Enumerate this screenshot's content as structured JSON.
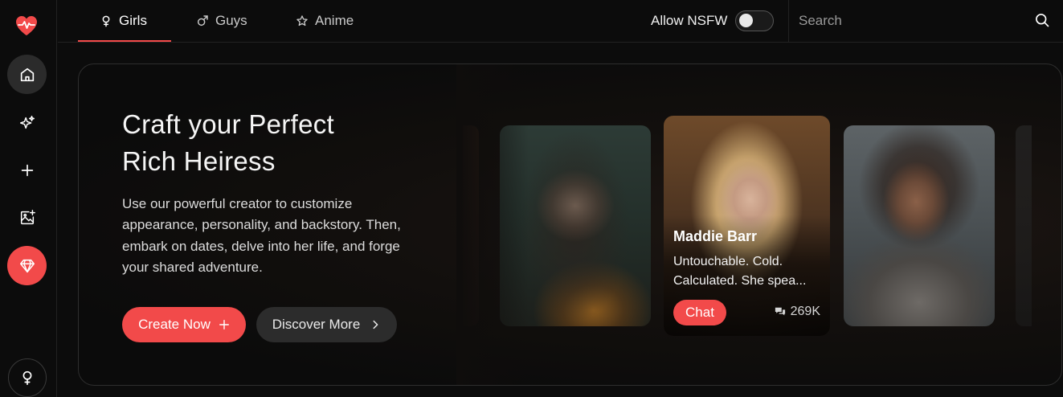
{
  "nav": {
    "tabs": [
      {
        "label": "Girls",
        "icon": "female-icon",
        "active": true
      },
      {
        "label": "Guys",
        "icon": "male-icon",
        "active": false
      },
      {
        "label": "Anime",
        "icon": "star-icon",
        "active": false
      }
    ],
    "nsfw_label": "Allow NSFW",
    "nsfw_enabled": false,
    "search_placeholder": "Search"
  },
  "sidebar": {
    "items": [
      {
        "icon": "home-icon",
        "active": true
      },
      {
        "icon": "sparkle-icon"
      },
      {
        "icon": "plus-icon"
      },
      {
        "icon": "image-add-icon"
      },
      {
        "icon": "diamond-icon"
      }
    ],
    "footer_icon": "female-icon"
  },
  "hero": {
    "title_line1": "Craft your Perfect",
    "title_line2": "Rich Heiress",
    "description": "Use our powerful creator to customize appearance, personality, and backstory. Then, embark on dates, delve into her life, and forge your shared adventure.",
    "create_label": "Create Now",
    "discover_label": "Discover More"
  },
  "featured_card": {
    "name": "Maddie Barr",
    "description": "Untouchable. Cold. Calculated. She spea...",
    "chat_label": "Chat",
    "count": "269K"
  },
  "colors": {
    "accent": "#f24a4a",
    "background": "#0c0c0c"
  }
}
